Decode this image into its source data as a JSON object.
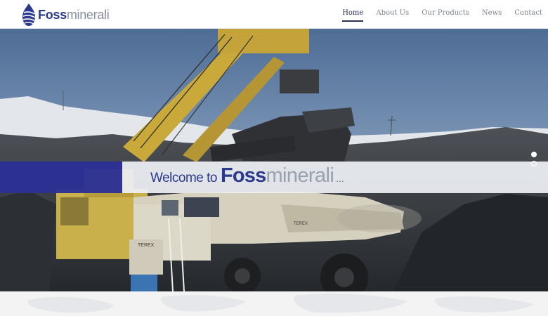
{
  "header": {
    "logo_bold": "Foss",
    "logo_light": "minerali",
    "logo_icon": "drop-swirl-icon",
    "nav": [
      {
        "label": "Home",
        "active": true
      },
      {
        "label": "About Us",
        "active": false
      },
      {
        "label": "Our Products",
        "active": false
      },
      {
        "label": "News",
        "active": false
      },
      {
        "label": "Contact",
        "active": false
      }
    ]
  },
  "hero": {
    "welcome_prefix": "Welcome to",
    "brand_bold": "Foss",
    "brand_light": "minerali",
    "ellipsis": "...",
    "slide_count": 2,
    "active_slide": 1,
    "truck_lettering": [
      "TEREX",
      "TEREX"
    ]
  },
  "colors": {
    "brand_blue": "#2b3a8c",
    "band_blue": "#2a2f96",
    "brand_grey": "#9aa0ad",
    "nav_text": "#7c8390",
    "nav_active": "#2a3254"
  }
}
